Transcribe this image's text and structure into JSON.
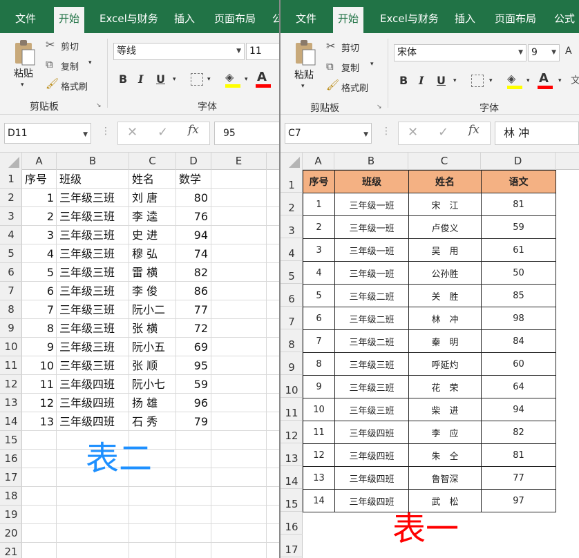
{
  "ribbon_tabs": [
    "文件",
    "开始",
    "Excel与财务",
    "插入",
    "页面布局",
    "公式"
  ],
  "ribbon": {
    "paste": "粘贴",
    "cut": "剪切",
    "copy": "复制",
    "format_painter": "格式刷",
    "clipboard_group": "剪贴板",
    "font_group": "字体",
    "bold": "B",
    "italic": "I",
    "underline": "U",
    "font_color_glyph": "A",
    "fx": "fx"
  },
  "colors": {
    "excel_green": "#217346",
    "header_fill": "#f4b183",
    "label_blue": "#1e90ff",
    "label_red": "#ff0000"
  },
  "left": {
    "font_name": "等线",
    "font_size": "11",
    "name_box": "D11",
    "formula_value": "95",
    "columns": [
      "A",
      "B",
      "C",
      "D",
      "E"
    ],
    "rows": [
      "1",
      "2",
      "3",
      "4",
      "5",
      "6",
      "7",
      "8",
      "9",
      "10",
      "11",
      "12",
      "13",
      "14",
      "15",
      "16",
      "17",
      "18",
      "19",
      "20",
      "21"
    ],
    "header": [
      "序号",
      "班级",
      "姓名",
      "数学"
    ],
    "data": [
      [
        "1",
        "三年级三班",
        "刘 唐",
        "80"
      ],
      [
        "2",
        "三年级三班",
        "李 逵",
        "76"
      ],
      [
        "3",
        "三年级三班",
        "史 进",
        "94"
      ],
      [
        "4",
        "三年级三班",
        "穆 弘",
        "74"
      ],
      [
        "5",
        "三年级三班",
        "雷 横",
        "82"
      ],
      [
        "6",
        "三年级三班",
        "李 俊",
        "86"
      ],
      [
        "7",
        "三年级三班",
        "阮小二",
        "77"
      ],
      [
        "8",
        "三年级三班",
        "张 横",
        "72"
      ],
      [
        "9",
        "三年级三班",
        "阮小五",
        "69"
      ],
      [
        "10",
        "三年级三班",
        "张 顺",
        "95"
      ],
      [
        "11",
        "三年级四班",
        "阮小七",
        "59"
      ],
      [
        "12",
        "三年级四班",
        "扬 雄",
        "96"
      ],
      [
        "13",
        "三年级四班",
        "石 秀",
        "79"
      ]
    ],
    "label": "表二"
  },
  "right": {
    "font_name": "宋体",
    "font_size": "9",
    "name_box": "C7",
    "formula_value": "林 冲",
    "columns": [
      "A",
      "B",
      "C",
      "D"
    ],
    "rows": [
      "1",
      "2",
      "3",
      "4",
      "5",
      "6",
      "7",
      "8",
      "9",
      "10",
      "11",
      "12",
      "13",
      "14",
      "15",
      "16",
      "17"
    ],
    "header": [
      "序号",
      "班级",
      "姓名",
      "语文"
    ],
    "data": [
      [
        "1",
        "三年级一班",
        "宋　江",
        "81"
      ],
      [
        "2",
        "三年级一班",
        "卢俊义",
        "59"
      ],
      [
        "3",
        "三年级一班",
        "吴　用",
        "61"
      ],
      [
        "4",
        "三年级一班",
        "公孙胜",
        "50"
      ],
      [
        "5",
        "三年级二班",
        "关　胜",
        "85"
      ],
      [
        "6",
        "三年级二班",
        "林　冲",
        "98"
      ],
      [
        "7",
        "三年级二班",
        "秦　明",
        "84"
      ],
      [
        "8",
        "三年级三班",
        "呼延灼",
        "60"
      ],
      [
        "9",
        "三年级三班",
        "花　荣",
        "64"
      ],
      [
        "10",
        "三年级三班",
        "柴　进",
        "94"
      ],
      [
        "11",
        "三年级四班",
        "李　应",
        "82"
      ],
      [
        "12",
        "三年级四班",
        "朱　仝",
        "81"
      ],
      [
        "13",
        "三年级四班",
        "鲁智深",
        "77"
      ],
      [
        "14",
        "三年级四班",
        "武　松",
        "97"
      ]
    ],
    "label": "表一"
  }
}
